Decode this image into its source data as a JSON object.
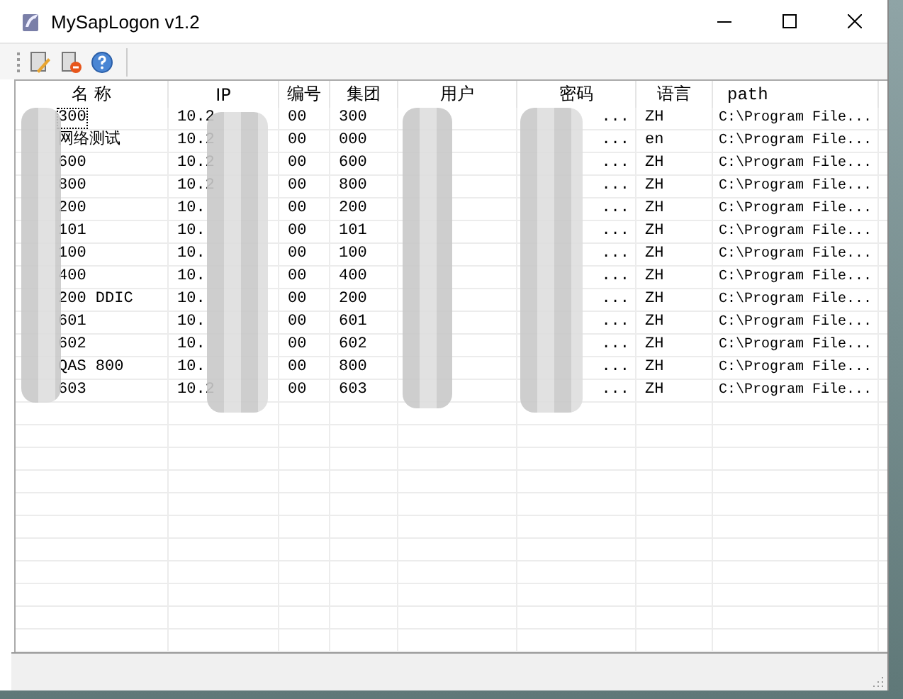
{
  "window": {
    "title": "MySapLogon v1.2"
  },
  "table": {
    "columns": [
      "名 称",
      "IP",
      "编号",
      "集团",
      "用户",
      "密码",
      "语言",
      "path"
    ],
    "rows": [
      {
        "cells": [
          "300",
          "10.2",
          "00",
          "300",
          "",
          "...",
          "ZH",
          "C:\\Program File..."
        ],
        "focused": true
      },
      {
        "cells": [
          "网络测试",
          "10.2",
          "00",
          "000",
          "",
          "...",
          "en",
          "C:\\Program File..."
        ],
        "focused": false
      },
      {
        "cells": [
          "600",
          "10.2",
          "00",
          "600",
          "",
          "...",
          "ZH",
          "C:\\Program File..."
        ],
        "focused": false
      },
      {
        "cells": [
          "800",
          "10.2",
          "00",
          "800",
          "",
          "...",
          "ZH",
          "C:\\Program File..."
        ],
        "focused": false
      },
      {
        "cells": [
          "200",
          "10.",
          "00",
          "200",
          "",
          "...",
          "ZH",
          "C:\\Program File..."
        ],
        "focused": false
      },
      {
        "cells": [
          "101",
          "10.",
          "00",
          "101",
          "",
          "...",
          "ZH",
          "C:\\Program File..."
        ],
        "focused": false
      },
      {
        "cells": [
          "100",
          "10.",
          "00",
          "100",
          "",
          "...",
          "ZH",
          "C:\\Program File..."
        ],
        "focused": false
      },
      {
        "cells": [
          "400",
          "10.",
          "00",
          "400",
          "",
          "...",
          "ZH",
          "C:\\Program File..."
        ],
        "focused": false
      },
      {
        "cells": [
          "200 DDIC",
          "10.",
          "00",
          "200",
          "",
          "...",
          "ZH",
          "C:\\Program File..."
        ],
        "focused": false
      },
      {
        "cells": [
          "601",
          "10.",
          "00",
          "601",
          "",
          "...",
          "ZH",
          "C:\\Program File..."
        ],
        "focused": false
      },
      {
        "cells": [
          "602",
          "10.",
          "00",
          "602",
          "",
          "...",
          "ZH",
          "C:\\Program File..."
        ],
        "focused": false
      },
      {
        "cells": [
          "QAS 800",
          "10.",
          "00",
          "800",
          "",
          "...",
          "ZH",
          "C:\\Program File..."
        ],
        "focused": false
      },
      {
        "cells": [
          "603",
          "10.2",
          "00",
          "603",
          "",
          "...",
          "ZH",
          "C:\\Program File..."
        ],
        "focused": false
      }
    ]
  }
}
